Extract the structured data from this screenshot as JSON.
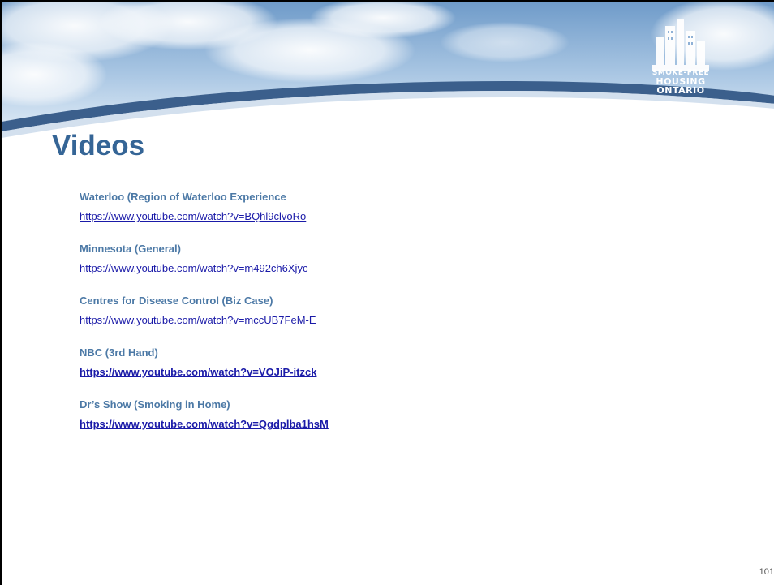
{
  "logo": {
    "line1": "SMOKE-FREE",
    "line2": "HOUSING",
    "line3": "ONTARIO"
  },
  "title": "Videos",
  "videos": [
    {
      "label": "Waterloo (Region of Waterloo Experience",
      "url": "https://www.youtube.com/watch?v=BQhl9clvoRo",
      "bold_link": false
    },
    {
      "label": "Minnesota (General)",
      "url": "https://www.youtube.com/watch?v=m492ch6Xjyc",
      "bold_link": false
    },
    {
      "label": "Centres for Disease Control (Biz Case)",
      "url": "https://www.youtube.com/watch?v=mccUB7FeM-E",
      "bold_link": false
    },
    {
      "label": "NBC (3rd Hand)",
      "url": "https://www.youtube.com/watch?v=VOJiP-itzck",
      "bold_link": true
    },
    {
      "label": "Dr’s Show (Smoking in Home)",
      "url": "https://www.youtube.com/watch?v=Qgdplba1hsM",
      "bold_link": true
    }
  ],
  "page_number": "101",
  "colors": {
    "title": "#356596",
    "label": "#4c79a6",
    "link": "#1a1aa8",
    "sky_top": "#6f9bc9",
    "swoosh": "#3b5f8c"
  }
}
